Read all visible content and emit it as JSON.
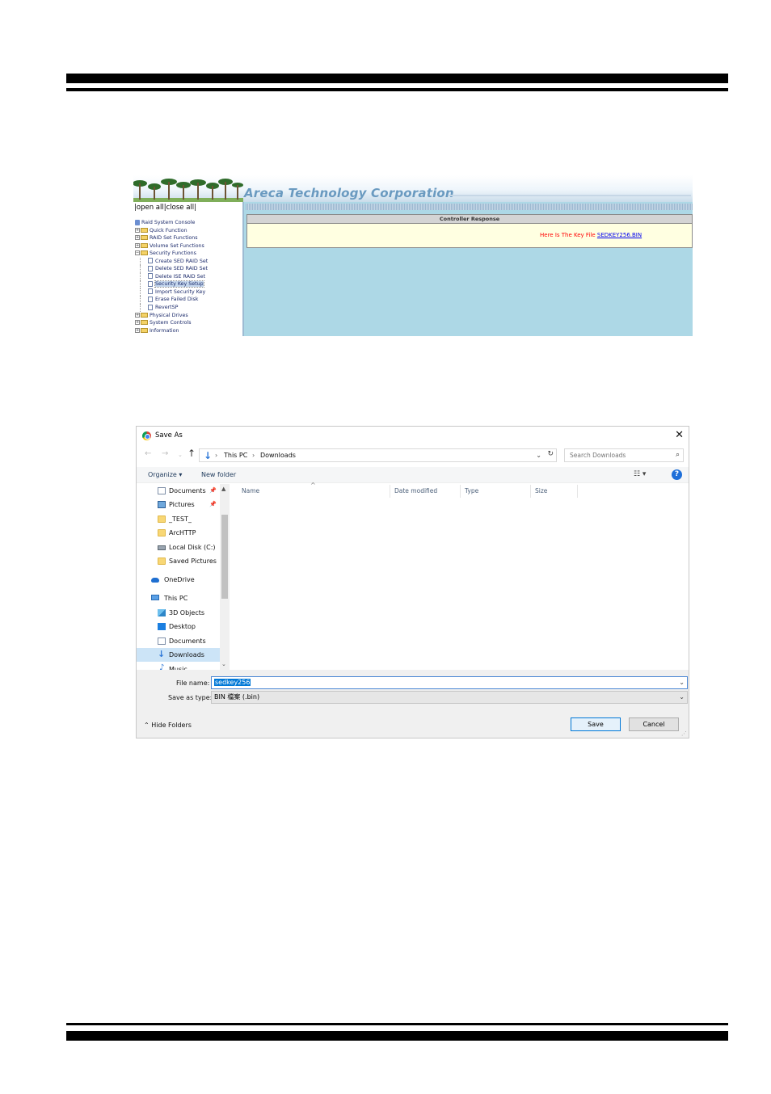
{
  "areca": {
    "brand": "Areca Technology Corporation",
    "open_all": "open all",
    "close_all": "close all",
    "tree": {
      "root": "Raid System Console",
      "quick_function": "Quick Function",
      "raid_set_functions": "RAID Set Functions",
      "volume_set_functions": "Volume Set Functions",
      "security_functions": "Security Functions",
      "security_items": [
        "Create SED RAID Set",
        "Delete SED RAID Set",
        "Delete ISE RAID Set",
        "Security Key Setup",
        "Import Security Key",
        "Erase Failed Disk",
        "RevertSP"
      ],
      "physical_drives": "Physical Drives",
      "system_controls": "System Controls",
      "information": "Information"
    },
    "response_header": "Controller Response",
    "response_text": "Here Is The Key File",
    "response_link": "SEDKEY256.BIN"
  },
  "dialog": {
    "title": "Save As",
    "breadcrumbs": [
      "This PC",
      "Downloads"
    ],
    "search_placeholder": "Search Downloads",
    "organize": "Organize ▾",
    "new_folder": "New folder",
    "nav_items": [
      {
        "label": "Documents",
        "icon": "documents-icon",
        "pinned": true
      },
      {
        "label": "Pictures",
        "icon": "pictures-icon",
        "pinned": true
      },
      {
        "label": "_TEST_",
        "icon": "folder-icon"
      },
      {
        "label": "ArcHTTP",
        "icon": "folder-icon"
      },
      {
        "label": "Local Disk (C:)",
        "icon": "local-disk-icon"
      },
      {
        "label": "Saved Pictures",
        "icon": "folder-icon"
      },
      {
        "label": "OneDrive",
        "icon": "onedrive-icon"
      },
      {
        "label": "This PC",
        "icon": "this-pc-icon"
      },
      {
        "label": "3D Objects",
        "icon": "3d-objects-icon"
      },
      {
        "label": "Desktop",
        "icon": "desktop-icon"
      },
      {
        "label": "Documents",
        "icon": "documents-icon"
      },
      {
        "label": "Downloads",
        "icon": "downloads-icon",
        "selected": true
      },
      {
        "label": "Music",
        "icon": "music-icon"
      }
    ],
    "columns": [
      "Name",
      "Date modified",
      "Type",
      "Size"
    ],
    "file_name_label": "File name:",
    "file_name_value": "sedkey256",
    "save_type_label": "Save as type:",
    "save_type_value": "BIN 檔案 (.bin)",
    "hide_folders": "Hide Folders",
    "save_button": "Save",
    "cancel_button": "Cancel"
  }
}
